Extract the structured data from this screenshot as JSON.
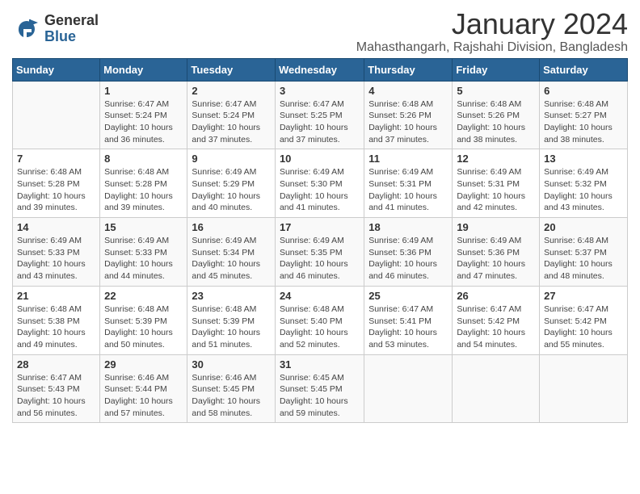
{
  "header": {
    "logo_general": "General",
    "logo_blue": "Blue",
    "month_title": "January 2024",
    "location": "Mahasthangarh, Rajshahi Division, Bangladesh"
  },
  "days_of_week": [
    "Sunday",
    "Monday",
    "Tuesday",
    "Wednesday",
    "Thursday",
    "Friday",
    "Saturday"
  ],
  "weeks": [
    [
      {
        "day": "",
        "info": ""
      },
      {
        "day": "1",
        "info": "Sunrise: 6:47 AM\nSunset: 5:24 PM\nDaylight: 10 hours\nand 36 minutes."
      },
      {
        "day": "2",
        "info": "Sunrise: 6:47 AM\nSunset: 5:24 PM\nDaylight: 10 hours\nand 37 minutes."
      },
      {
        "day": "3",
        "info": "Sunrise: 6:47 AM\nSunset: 5:25 PM\nDaylight: 10 hours\nand 37 minutes."
      },
      {
        "day": "4",
        "info": "Sunrise: 6:48 AM\nSunset: 5:26 PM\nDaylight: 10 hours\nand 37 minutes."
      },
      {
        "day": "5",
        "info": "Sunrise: 6:48 AM\nSunset: 5:26 PM\nDaylight: 10 hours\nand 38 minutes."
      },
      {
        "day": "6",
        "info": "Sunrise: 6:48 AM\nSunset: 5:27 PM\nDaylight: 10 hours\nand 38 minutes."
      }
    ],
    [
      {
        "day": "7",
        "info": "Sunrise: 6:48 AM\nSunset: 5:28 PM\nDaylight: 10 hours\nand 39 minutes."
      },
      {
        "day": "8",
        "info": "Sunrise: 6:48 AM\nSunset: 5:28 PM\nDaylight: 10 hours\nand 39 minutes."
      },
      {
        "day": "9",
        "info": "Sunrise: 6:49 AM\nSunset: 5:29 PM\nDaylight: 10 hours\nand 40 minutes."
      },
      {
        "day": "10",
        "info": "Sunrise: 6:49 AM\nSunset: 5:30 PM\nDaylight: 10 hours\nand 41 minutes."
      },
      {
        "day": "11",
        "info": "Sunrise: 6:49 AM\nSunset: 5:31 PM\nDaylight: 10 hours\nand 41 minutes."
      },
      {
        "day": "12",
        "info": "Sunrise: 6:49 AM\nSunset: 5:31 PM\nDaylight: 10 hours\nand 42 minutes."
      },
      {
        "day": "13",
        "info": "Sunrise: 6:49 AM\nSunset: 5:32 PM\nDaylight: 10 hours\nand 43 minutes."
      }
    ],
    [
      {
        "day": "14",
        "info": "Sunrise: 6:49 AM\nSunset: 5:33 PM\nDaylight: 10 hours\nand 43 minutes."
      },
      {
        "day": "15",
        "info": "Sunrise: 6:49 AM\nSunset: 5:33 PM\nDaylight: 10 hours\nand 44 minutes."
      },
      {
        "day": "16",
        "info": "Sunrise: 6:49 AM\nSunset: 5:34 PM\nDaylight: 10 hours\nand 45 minutes."
      },
      {
        "day": "17",
        "info": "Sunrise: 6:49 AM\nSunset: 5:35 PM\nDaylight: 10 hours\nand 46 minutes."
      },
      {
        "day": "18",
        "info": "Sunrise: 6:49 AM\nSunset: 5:36 PM\nDaylight: 10 hours\nand 46 minutes."
      },
      {
        "day": "19",
        "info": "Sunrise: 6:49 AM\nSunset: 5:36 PM\nDaylight: 10 hours\nand 47 minutes."
      },
      {
        "day": "20",
        "info": "Sunrise: 6:48 AM\nSunset: 5:37 PM\nDaylight: 10 hours\nand 48 minutes."
      }
    ],
    [
      {
        "day": "21",
        "info": "Sunrise: 6:48 AM\nSunset: 5:38 PM\nDaylight: 10 hours\nand 49 minutes."
      },
      {
        "day": "22",
        "info": "Sunrise: 6:48 AM\nSunset: 5:39 PM\nDaylight: 10 hours\nand 50 minutes."
      },
      {
        "day": "23",
        "info": "Sunrise: 6:48 AM\nSunset: 5:39 PM\nDaylight: 10 hours\nand 51 minutes."
      },
      {
        "day": "24",
        "info": "Sunrise: 6:48 AM\nSunset: 5:40 PM\nDaylight: 10 hours\nand 52 minutes."
      },
      {
        "day": "25",
        "info": "Sunrise: 6:47 AM\nSunset: 5:41 PM\nDaylight: 10 hours\nand 53 minutes."
      },
      {
        "day": "26",
        "info": "Sunrise: 6:47 AM\nSunset: 5:42 PM\nDaylight: 10 hours\nand 54 minutes."
      },
      {
        "day": "27",
        "info": "Sunrise: 6:47 AM\nSunset: 5:42 PM\nDaylight: 10 hours\nand 55 minutes."
      }
    ],
    [
      {
        "day": "28",
        "info": "Sunrise: 6:47 AM\nSunset: 5:43 PM\nDaylight: 10 hours\nand 56 minutes."
      },
      {
        "day": "29",
        "info": "Sunrise: 6:46 AM\nSunset: 5:44 PM\nDaylight: 10 hours\nand 57 minutes."
      },
      {
        "day": "30",
        "info": "Sunrise: 6:46 AM\nSunset: 5:45 PM\nDaylight: 10 hours\nand 58 minutes."
      },
      {
        "day": "31",
        "info": "Sunrise: 6:45 AM\nSunset: 5:45 PM\nDaylight: 10 hours\nand 59 minutes."
      },
      {
        "day": "",
        "info": ""
      },
      {
        "day": "",
        "info": ""
      },
      {
        "day": "",
        "info": ""
      }
    ]
  ]
}
